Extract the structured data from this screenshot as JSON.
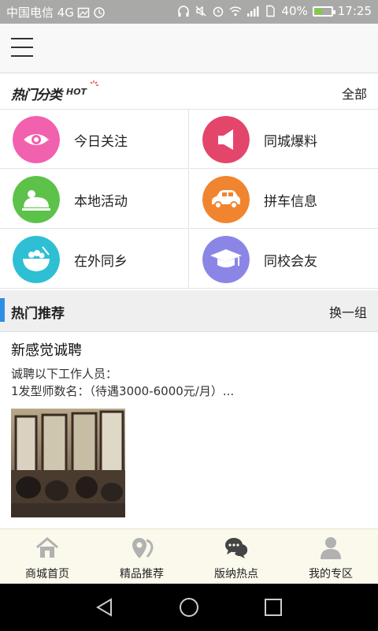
{
  "status_bar": {
    "carrier": "中国电信 4G",
    "battery": "40%",
    "time": "17:25"
  },
  "hot_categories": {
    "title": "热门分类",
    "badge": "HOT",
    "all_label": "全部",
    "items": [
      {
        "label": "今日关注",
        "icon": "eye-icon",
        "color": "#f261ad"
      },
      {
        "label": "同城爆料",
        "icon": "megaphone-icon",
        "color": "#e4466b"
      },
      {
        "label": "本地活动",
        "icon": "event-icon",
        "color": "#5cc24a"
      },
      {
        "label": "拼车信息",
        "icon": "car-icon",
        "color": "#f1842e"
      },
      {
        "label": "在外同乡",
        "icon": "bowl-icon",
        "color": "#2ebfd4"
      },
      {
        "label": "同校会友",
        "icon": "graduation-cap-icon",
        "color": "#8b86e6"
      }
    ]
  },
  "recommend": {
    "title": "热门推荐",
    "switch_label": "换一组",
    "accent": "#2f8de4"
  },
  "article": {
    "title": "新感觉诚聘",
    "line1": "诚聘以下工作人员：",
    "line2": "1发型师数名：（待遇3000-6000元/月）..."
  },
  "bottom_nav": [
    {
      "label": "商城首页",
      "icon": "home-icon"
    },
    {
      "label": "精品推荐",
      "icon": "location-pin-icon"
    },
    {
      "label": "版纳热点",
      "icon": "chat-bubbles-icon"
    },
    {
      "label": "我的专区",
      "icon": "user-icon"
    }
  ]
}
